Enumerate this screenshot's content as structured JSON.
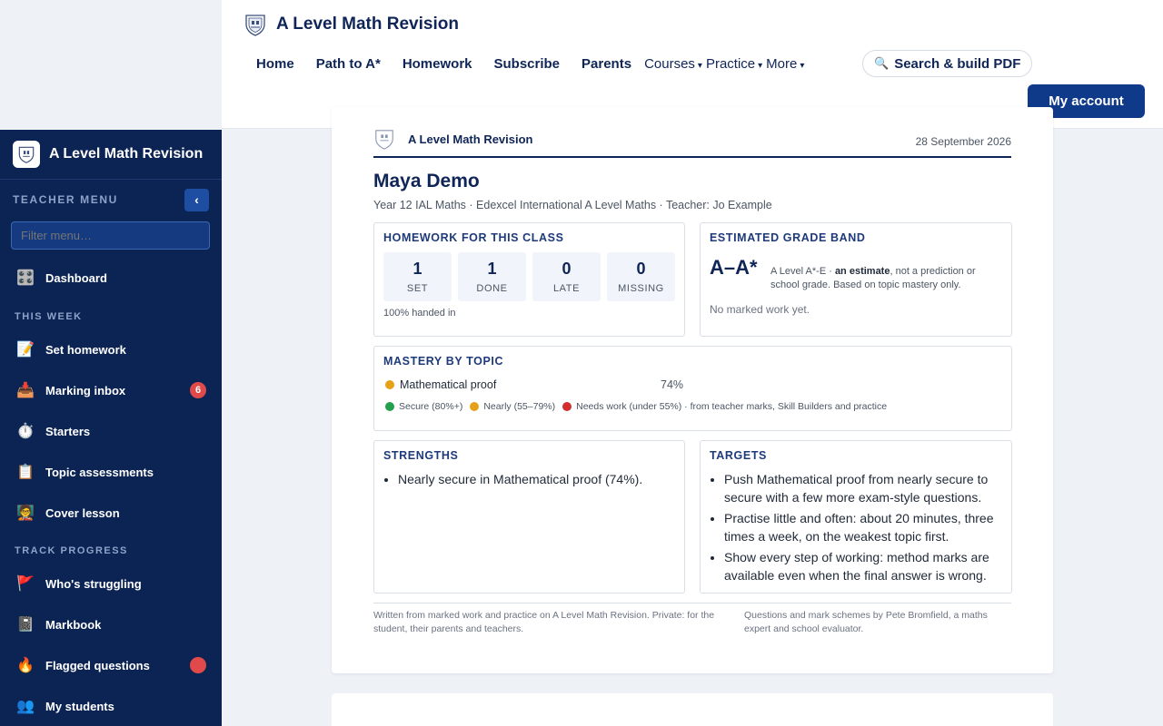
{
  "header": {
    "title": "A Level Math Revision",
    "nav": [
      "Home",
      "Path to A*",
      "Homework",
      "Subscribe",
      "Parents"
    ],
    "dropdowns": [
      "Courses",
      "Practice",
      "More"
    ],
    "search_label": "Search & build PDF",
    "account_label": "My account"
  },
  "sidebar": {
    "title": "A Level Math Revision",
    "menu_label": "TEACHER MENU",
    "filter_placeholder": "Filter menu…",
    "dashboard": "Dashboard",
    "section_this_week": "THIS WEEK",
    "this_week": [
      {
        "label": "Set homework",
        "icon": "📝"
      },
      {
        "label": "Marking inbox",
        "icon": "📥",
        "badge": "6"
      },
      {
        "label": "Starters",
        "icon": "⏱️"
      },
      {
        "label": "Topic assessments",
        "icon": "📋"
      },
      {
        "label": "Cover lesson",
        "icon": "🧑‍🏫"
      }
    ],
    "section_track": "TRACK PROGRESS",
    "track": [
      {
        "label": "Who's struggling",
        "icon": "🚩"
      },
      {
        "label": "Markbook",
        "icon": "📓"
      },
      {
        "label": "Flagged questions",
        "icon": "🔥",
        "badge": ""
      },
      {
        "label": "My students",
        "icon": "👥"
      }
    ],
    "colors": {
      "bg": "#0c2454",
      "badge": "#e04a4a"
    }
  },
  "report": {
    "brand": "A Level Math Revision",
    "date": "28 September 2026",
    "student_name": "Maya Demo",
    "student_sub": "Year 12 IAL Maths · Edexcel International A Level Maths · Teacher: Jo Example",
    "homework": {
      "title": "HOMEWORK FOR THIS CLASS",
      "stats": [
        {
          "num": "1",
          "label": "SET"
        },
        {
          "num": "1",
          "label": "DONE"
        },
        {
          "num": "0",
          "label": "LATE"
        },
        {
          "num": "0",
          "label": "MISSING"
        }
      ],
      "handed_in": "100% handed in"
    },
    "grade": {
      "title": "ESTIMATED GRADE BAND",
      "band": "A–A*",
      "note_pre": "A Level A*-E · ",
      "note_bold": "an estimate",
      "note_post": ", not a prediction or school grade. Based on topic mastery only.",
      "no_marked": "No marked work yet."
    },
    "mastery": {
      "title": "MASTERY BY TOPIC",
      "topic": "Mathematical proof",
      "pct": "74%",
      "legend_secure": "Secure (80%+)",
      "legend_nearly": "Nearly (55–79%)",
      "legend_needs": "Needs work (under 55%) · from teacher marks, Skill Builders and practice",
      "colors": {
        "secure": "#22a04b",
        "nearly": "#e6a118",
        "needs": "#d12f2f"
      }
    },
    "strengths": {
      "title": "STRENGTHS",
      "items": [
        "Nearly secure in Mathematical proof (74%)."
      ]
    },
    "targets": {
      "title": "TARGETS",
      "items": [
        "Push Mathematical proof from nearly secure to secure with a few more exam-style questions.",
        "Practise little and often: about 20 minutes, three times a week, on the weakest topic first.",
        "Show every step of working: method marks are available even when the final answer is wrong."
      ]
    },
    "footer_left": "Written from marked work and practice on A Level Math Revision. Private: for the student, their parents and teachers.",
    "footer_right": "Questions and mark schemes by Pete Bromfield, a maths expert and school evaluator."
  }
}
